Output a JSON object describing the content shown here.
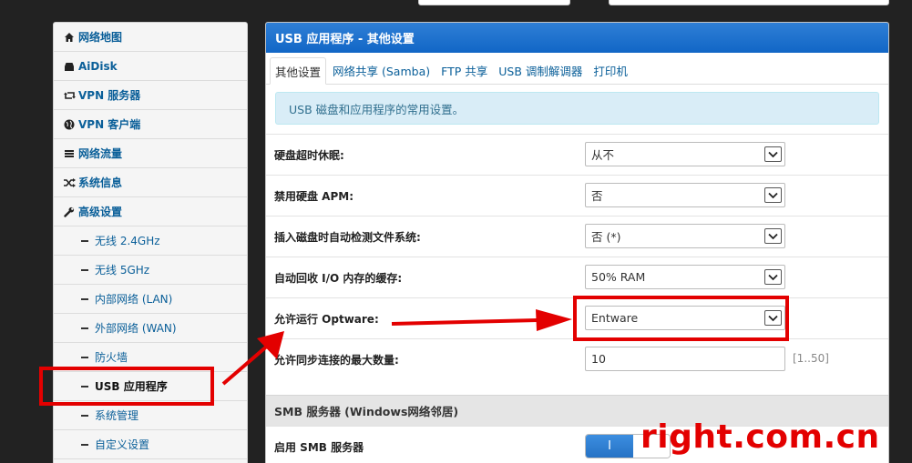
{
  "sidebar": {
    "items": [
      {
        "label": "网络地图",
        "icon": "home-icon"
      },
      {
        "label": "AiDisk",
        "icon": "drive-icon"
      },
      {
        "label": "VPN 服务器",
        "icon": "retweet-icon"
      },
      {
        "label": "VPN 客户端",
        "icon": "globe-icon"
      },
      {
        "label": "网络流量",
        "icon": "list-icon"
      },
      {
        "label": "系统信息",
        "icon": "shuffle-icon"
      },
      {
        "label": "高级设置",
        "icon": "wrench-icon"
      }
    ],
    "subitems": [
      {
        "label": "无线 2.4GHz"
      },
      {
        "label": "无线 5GHz"
      },
      {
        "label": "内部网络 (LAN)"
      },
      {
        "label": "外部网络 (WAN)"
      },
      {
        "label": "防火墙"
      },
      {
        "label": "USB 应用程序",
        "active": true
      },
      {
        "label": "系统管理"
      },
      {
        "label": "自定义设置"
      }
    ]
  },
  "panel": {
    "title": "USB 应用程序 - 其他设置",
    "tabs": [
      {
        "label": "其他设置",
        "active": true
      },
      {
        "label": "网络共享 (Samba)"
      },
      {
        "label": "FTP 共享"
      },
      {
        "label": "USB 调制解调器"
      },
      {
        "label": "打印机"
      }
    ],
    "info": "USB 磁盘和应用程序的常用设置。",
    "settings": [
      {
        "label": "硬盘超时休眠:",
        "value": "从不"
      },
      {
        "label": "禁用硬盘 APM:",
        "value": "否"
      },
      {
        "label": "插入磁盘时自动检测文件系统:",
        "value": "否 (*)"
      },
      {
        "label": "自动回收 I/O 内存的缓存:",
        "value": "50% RAM"
      },
      {
        "label": "允许运行 Optware:",
        "value": "Entware"
      },
      {
        "label": "允许同步连接的最大数量:",
        "value": "10",
        "hint": "[1..50]"
      }
    ],
    "smb_section": "SMB 服务器 (Windows网络邻居)",
    "smb_enable_label": "启用 SMB 服务器",
    "smb_toggle_on": "I"
  },
  "watermark": "right.com.cn",
  "colors": {
    "annotation": "#e30000",
    "header": "#1a6fcc",
    "link": "#0a5f99"
  }
}
